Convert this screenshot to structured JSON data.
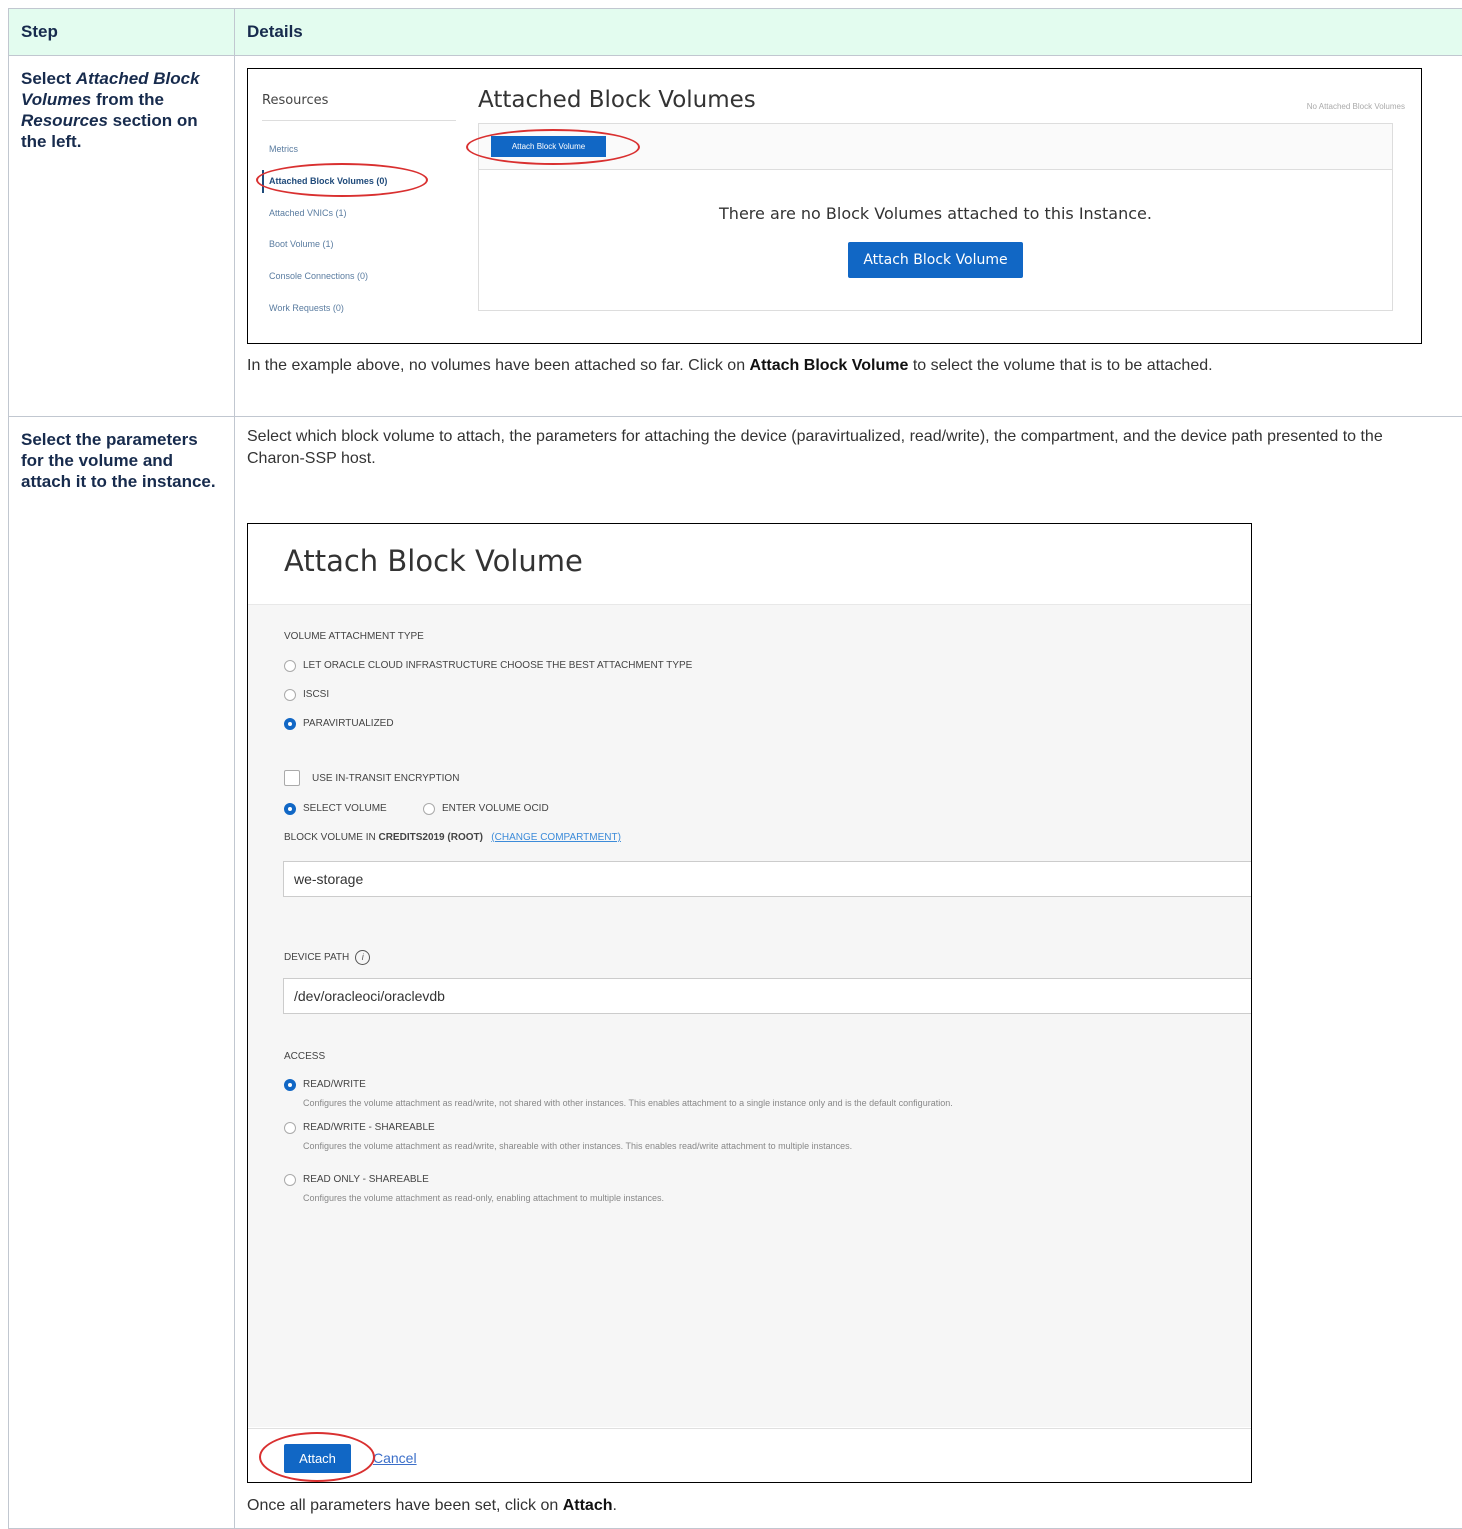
{
  "table": {
    "headers": {
      "step": "Step",
      "details": "Details"
    },
    "row1": {
      "step_parts": [
        "Select ",
        "Attached Block Volumes",
        " from the ",
        "Resources",
        " section on the left."
      ],
      "paragraph_parts": [
        "In the example above, no volumes have been attached so far. Click on ",
        "Attach Block Volume",
        " to select the volume that is to be attached."
      ]
    },
    "row2": {
      "step": "Select the parameters for the volume and attach it to the instance.",
      "intro": "Select which block volume to attach, the parameters for attaching the device (paravirtualized, read/write), the compartment, and the device path presented to the Charon-SSP host.",
      "outro_parts": [
        "Once all parameters have been set, click on ",
        "Attach",
        "."
      ]
    }
  },
  "screenshot1": {
    "resources_title": "Resources",
    "resource_items": [
      "Metrics",
      "Attached Block Volumes (0)",
      "Attached VNICs (1)",
      "Boot Volume (1)",
      "Console Connections (0)",
      "Work Requests (0)"
    ],
    "active_item_index": 1,
    "title": "Attached Block Volumes",
    "status_right": "No Attached Block Volumes",
    "small_button": "Attach Block Volume",
    "empty_message": "There are no Block Volumes attached to this Instance.",
    "big_button": "Attach Block Volume",
    "colors": {
      "button": "#1167c5",
      "highlight": "#d93030"
    }
  },
  "screenshot2": {
    "title": "Attach Block Volume",
    "attachment_type_label": "VOLUME ATTACHMENT TYPE",
    "attachment_options": [
      "LET ORACLE CLOUD INFRASTRUCTURE CHOOSE THE BEST ATTACHMENT TYPE",
      "ISCSI",
      "PARAVIRTUALIZED"
    ],
    "attachment_selected": "PARAVIRTUALIZED",
    "encryption_label": "USE IN-TRANSIT ENCRYPTION",
    "volume_mode_options": [
      "SELECT VOLUME",
      "ENTER VOLUME OCID"
    ],
    "volume_mode_selected": "SELECT VOLUME",
    "block_volume_in": "BLOCK VOLUME IN",
    "compartment": "CREDITS2019 (ROOT)",
    "change_compartment": "(CHANGE COMPARTMENT)",
    "volume_value": "we-storage",
    "device_path_label": "DEVICE PATH",
    "device_path_value": "/dev/oracleoci/oraclevdb",
    "access_label": "ACCESS",
    "access_options": [
      {
        "label": "READ/WRITE",
        "hint": "Configures the volume attachment as read/write, not shared with other instances. This enables attachment to a single instance only and is the default configuration."
      },
      {
        "label": "READ/WRITE - SHAREABLE",
        "hint": "Configures the volume attachment as read/write, shareable with other instances. This enables read/write attachment to multiple instances."
      },
      {
        "label": "READ ONLY - SHAREABLE",
        "hint": "Configures the volume attachment as read-only, enabling attachment to multiple instances."
      }
    ],
    "access_selected": "READ/WRITE",
    "attach_button": "Attach",
    "cancel_link": "Cancel"
  }
}
